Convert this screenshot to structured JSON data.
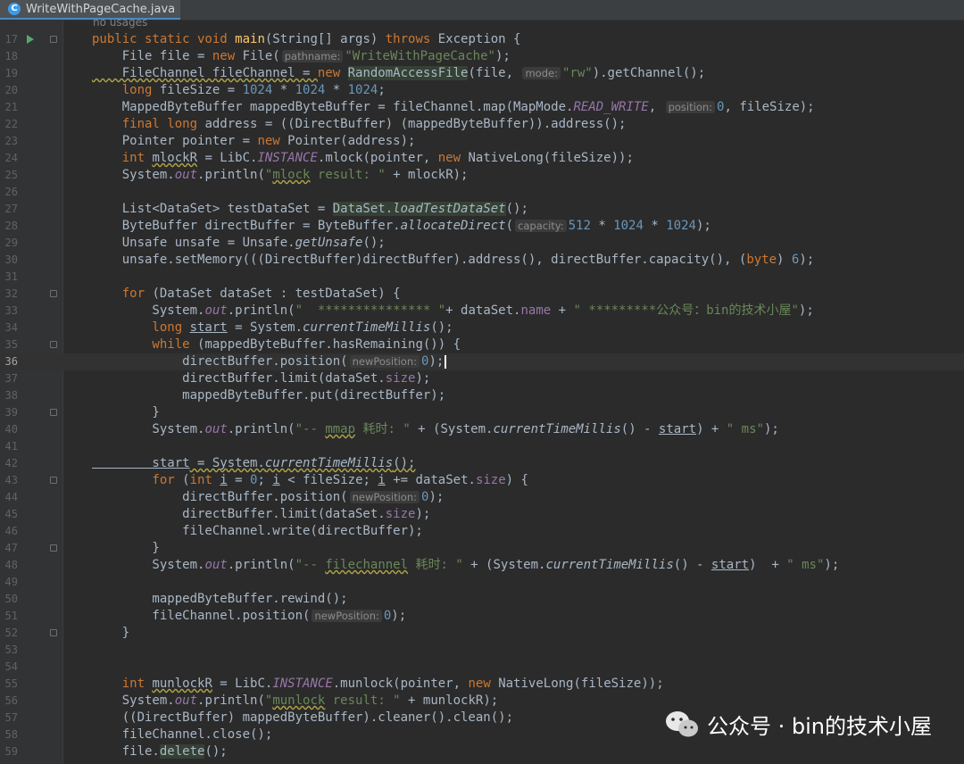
{
  "tab": {
    "title": "WriteWithPageCache.java",
    "icon": "java-class-icon"
  },
  "usages": "no usages",
  "watermark": {
    "text": "公众号 · bin的技术小屋",
    "icon": "wechat-icon"
  },
  "colors": {
    "background": "#2b2b2b",
    "keyword": "#cc7832",
    "string": "#6a8759",
    "number": "#6897bb",
    "field": "#9876aa",
    "method": "#ffc66d",
    "text": "#a9b7c6"
  },
  "editor": {
    "current_line": "36",
    "lines": [
      {
        "n": "17",
        "tokens": [
          [
            "kw",
            "public static void "
          ],
          [
            "fn",
            "main"
          ],
          [
            "p",
            "(String[] args) "
          ],
          [
            "kw",
            "throws "
          ],
          [
            "p",
            "Exception {"
          ]
        ]
      },
      {
        "n": "18",
        "tokens": [
          [
            "p",
            "    File file = "
          ],
          [
            "kw",
            "new "
          ],
          [
            "p",
            "File("
          ],
          [
            "hint",
            "pathname:"
          ],
          [
            "str",
            "\"WriteWithPageCache\""
          ],
          [
            "p",
            ");"
          ]
        ]
      },
      {
        "n": "19",
        "tokens": [
          [
            "wave",
            "    FileChannel fileChannel = "
          ],
          [
            "kw",
            "new "
          ],
          [
            "hl",
            "RandomAccessFile"
          ],
          [
            "p",
            "(file, "
          ],
          [
            "hint",
            "mode:"
          ],
          [
            "str",
            "\"rw\""
          ],
          [
            "p",
            ").getChannel();"
          ]
        ]
      },
      {
        "n": "20",
        "tokens": [
          [
            "kw",
            "    long "
          ],
          [
            "p",
            "fileSize = "
          ],
          [
            "num",
            "1024 "
          ],
          [
            "p",
            "* "
          ],
          [
            "num",
            "1024 "
          ],
          [
            "p",
            "* "
          ],
          [
            "num",
            "1024"
          ],
          [
            "p",
            ";"
          ]
        ]
      },
      {
        "n": "21",
        "tokens": [
          [
            "p",
            "    MappedByteBuffer mappedByteBuffer = fileChannel.map(MapMode."
          ],
          [
            "sfld",
            "READ_WRITE"
          ],
          [
            "p",
            ", "
          ],
          [
            "hint",
            "position:"
          ],
          [
            "num",
            "0"
          ],
          [
            "p",
            ", fileSize);"
          ]
        ]
      },
      {
        "n": "22",
        "tokens": [
          [
            "kw",
            "    final long "
          ],
          [
            "p",
            "address = ((DirectBuffer) (mappedByteBuffer)).address();"
          ]
        ]
      },
      {
        "n": "23",
        "tokens": [
          [
            "p",
            "    Pointer pointer = "
          ],
          [
            "kw",
            "new "
          ],
          [
            "p",
            "Pointer(address);"
          ]
        ]
      },
      {
        "n": "24",
        "tokens": [
          [
            "kw",
            "    int "
          ],
          [
            "wave",
            "mlockR"
          ],
          [
            "p",
            " = LibC."
          ],
          [
            "sfld",
            "INSTANCE"
          ],
          [
            "p",
            ".mlock(pointer, "
          ],
          [
            "kw",
            "new "
          ],
          [
            "p",
            "NativeLong(fileSize));"
          ]
        ]
      },
      {
        "n": "25",
        "tokens": [
          [
            "p",
            "    System."
          ],
          [
            "sfld",
            "out"
          ],
          [
            "p",
            ".println("
          ],
          [
            "str",
            "\""
          ],
          [
            "strwave",
            "mlock"
          ],
          [
            "str",
            " result: \" "
          ],
          [
            "p",
            "+ mlockR);"
          ]
        ]
      },
      {
        "n": "26",
        "tokens": []
      },
      {
        "n": "27",
        "tokens": [
          [
            "p",
            "    List<DataSet> testDataSet = "
          ],
          [
            "hl",
            "DataSet."
          ],
          [
            "hlsm",
            "loadTestDataSet"
          ],
          [
            "p",
            "();"
          ]
        ]
      },
      {
        "n": "28",
        "tokens": [
          [
            "p",
            "    ByteBuffer directBuffer = ByteBuffer."
          ],
          [
            "sm",
            "allocateDirect"
          ],
          [
            "p",
            "("
          ],
          [
            "hint",
            "capacity:"
          ],
          [
            "num",
            "512 "
          ],
          [
            "p",
            "* "
          ],
          [
            "num",
            "1024 "
          ],
          [
            "p",
            "* "
          ],
          [
            "num",
            "1024"
          ],
          [
            "p",
            ");"
          ]
        ]
      },
      {
        "n": "29",
        "tokens": [
          [
            "p",
            "    Unsafe unsafe = Unsafe."
          ],
          [
            "sm",
            "getUnsafe"
          ],
          [
            "p",
            "();"
          ]
        ]
      },
      {
        "n": "30",
        "tokens": [
          [
            "p",
            "    unsafe.setMemory(((DirectBuffer)directBuffer).address(), directBuffer.capacity(), ("
          ],
          [
            "kw",
            "byte"
          ],
          [
            "p",
            ") "
          ],
          [
            "num",
            "6"
          ],
          [
            "p",
            ");"
          ]
        ]
      },
      {
        "n": "31",
        "tokens": []
      },
      {
        "n": "32",
        "tokens": [
          [
            "kw",
            "    for "
          ],
          [
            "p",
            "(DataSet dataSet : testDataSet) {"
          ]
        ]
      },
      {
        "n": "33",
        "tokens": [
          [
            "p",
            "        System."
          ],
          [
            "sfld",
            "out"
          ],
          [
            "p",
            ".println("
          ],
          [
            "str",
            "\"  *************** \""
          ],
          [
            "p",
            "+ dataSet."
          ],
          [
            "fld",
            "name"
          ],
          [
            "p",
            " + "
          ],
          [
            "str",
            "\" *********公众号：bin的技术小屋\""
          ],
          [
            "p",
            ");"
          ]
        ]
      },
      {
        "n": "34",
        "tokens": [
          [
            "kw",
            "        long "
          ],
          [
            "ul",
            "start"
          ],
          [
            "p",
            " = System."
          ],
          [
            "sm",
            "currentTimeMillis"
          ],
          [
            "p",
            "();"
          ]
        ]
      },
      {
        "n": "35",
        "tokens": [
          [
            "kw",
            "        while "
          ],
          [
            "p",
            "(mappedByteBuffer.hasRemaining()) {"
          ]
        ]
      },
      {
        "n": "36",
        "tokens": [
          [
            "p",
            "            directBuffer.position("
          ],
          [
            "hint",
            "newPosition:"
          ],
          [
            "num",
            "0"
          ],
          [
            "p",
            ");"
          ],
          [
            "caret",
            ""
          ]
        ]
      },
      {
        "n": "37",
        "tokens": [
          [
            "p",
            "            directBuffer.limit(dataSet."
          ],
          [
            "fld",
            "size"
          ],
          [
            "p",
            ");"
          ]
        ]
      },
      {
        "n": "38",
        "tokens": [
          [
            "p",
            "            mappedByteBuffer.put(directBuffer);"
          ]
        ]
      },
      {
        "n": "39",
        "tokens": [
          [
            "p",
            "        }"
          ]
        ]
      },
      {
        "n": "40",
        "tokens": [
          [
            "p",
            "        System."
          ],
          [
            "sfld",
            "out"
          ],
          [
            "p",
            ".println("
          ],
          [
            "str",
            "\"-- "
          ],
          [
            "strwave",
            "mmap"
          ],
          [
            "str",
            " 耗时: \""
          ],
          [
            "p",
            " + (System."
          ],
          [
            "sm",
            "currentTimeMillis"
          ],
          [
            "p",
            "() - "
          ],
          [
            "ul",
            "start"
          ],
          [
            "p",
            ") + "
          ],
          [
            "str",
            "\" ms\""
          ],
          [
            "p",
            ");"
          ]
        ]
      },
      {
        "n": "41",
        "tokens": []
      },
      {
        "n": "42",
        "tokens": [
          [
            "ulwave",
            "        start"
          ],
          [
            "wave",
            " = System."
          ],
          [
            "wavesm",
            "currentTimeMillis"
          ],
          [
            "wave",
            "();"
          ]
        ]
      },
      {
        "n": "43",
        "tokens": [
          [
            "kw",
            "        for "
          ],
          [
            "p",
            "("
          ],
          [
            "kw",
            "int "
          ],
          [
            "ul",
            "i"
          ],
          [
            "p",
            " = "
          ],
          [
            "num",
            "0"
          ],
          [
            "p",
            "; "
          ],
          [
            "ul",
            "i"
          ],
          [
            "p",
            " < fileSize; "
          ],
          [
            "ul",
            "i"
          ],
          [
            "p",
            " += dataSet."
          ],
          [
            "fld",
            "size"
          ],
          [
            "p",
            ") {"
          ]
        ]
      },
      {
        "n": "44",
        "tokens": [
          [
            "p",
            "            directBuffer.position("
          ],
          [
            "hint",
            "newPosition:"
          ],
          [
            "num",
            "0"
          ],
          [
            "p",
            ");"
          ]
        ]
      },
      {
        "n": "45",
        "tokens": [
          [
            "p",
            "            directBuffer.limit(dataSet."
          ],
          [
            "fld",
            "size"
          ],
          [
            "p",
            ");"
          ]
        ]
      },
      {
        "n": "46",
        "tokens": [
          [
            "p",
            "            fileChannel.write(directBuffer);"
          ]
        ]
      },
      {
        "n": "47",
        "tokens": [
          [
            "p",
            "        }"
          ]
        ]
      },
      {
        "n": "48",
        "tokens": [
          [
            "p",
            "        System."
          ],
          [
            "sfld",
            "out"
          ],
          [
            "p",
            ".println("
          ],
          [
            "str",
            "\"-- "
          ],
          [
            "strwave",
            "filechannel"
          ],
          [
            "str",
            " 耗时: \""
          ],
          [
            "p",
            " + (System."
          ],
          [
            "sm",
            "currentTimeMillis"
          ],
          [
            "p",
            "() - "
          ],
          [
            "ul",
            "start"
          ],
          [
            "p",
            ")  + "
          ],
          [
            "str",
            "\" ms\""
          ],
          [
            "p",
            ");"
          ]
        ]
      },
      {
        "n": "49",
        "tokens": []
      },
      {
        "n": "50",
        "tokens": [
          [
            "p",
            "        mappedByteBuffer.rewind();"
          ]
        ]
      },
      {
        "n": "51",
        "tokens": [
          [
            "p",
            "        fileChannel.position("
          ],
          [
            "hint",
            "newPosition:"
          ],
          [
            "num",
            "0"
          ],
          [
            "p",
            ");"
          ]
        ]
      },
      {
        "n": "52",
        "tokens": [
          [
            "p",
            "    }"
          ]
        ]
      },
      {
        "n": "53",
        "tokens": []
      },
      {
        "n": "54",
        "tokens": []
      },
      {
        "n": "55",
        "tokens": [
          [
            "kw",
            "    int "
          ],
          [
            "wave",
            "munlockR"
          ],
          [
            "p",
            " = LibC."
          ],
          [
            "sfld",
            "INSTANCE"
          ],
          [
            "p",
            ".munlock(pointer, "
          ],
          [
            "kw",
            "new "
          ],
          [
            "p",
            "NativeLong(fileSize));"
          ]
        ]
      },
      {
        "n": "56",
        "tokens": [
          [
            "p",
            "    System."
          ],
          [
            "sfld",
            "out"
          ],
          [
            "p",
            ".println("
          ],
          [
            "str",
            "\""
          ],
          [
            "strwave",
            "munlock"
          ],
          [
            "str",
            " result: \" "
          ],
          [
            "p",
            "+ munlockR);"
          ]
        ]
      },
      {
        "n": "57",
        "tokens": [
          [
            "p",
            "    ((DirectBuffer) mappedByteBuffer).cleaner().clean();"
          ]
        ]
      },
      {
        "n": "58",
        "tokens": [
          [
            "p",
            "    fileChannel.close();"
          ]
        ]
      },
      {
        "n": "59",
        "tokens": [
          [
            "p",
            "    file."
          ],
          [
            "hl",
            "delete"
          ],
          [
            "p",
            "();"
          ]
        ]
      }
    ]
  }
}
